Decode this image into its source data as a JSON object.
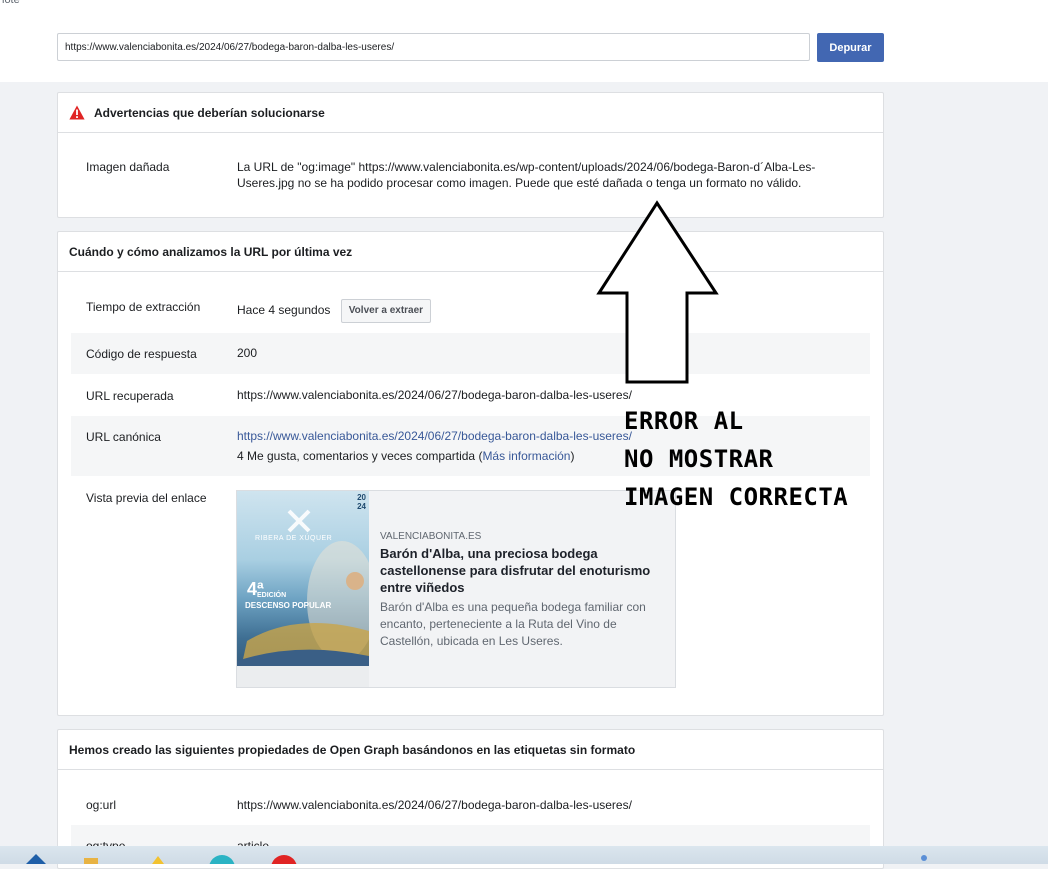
{
  "top": {
    "cut_text": "lote",
    "url_value": "https://www.valenciabonita.es/2024/06/27/bodega-baron-dalba-les-useres/",
    "debug_button": "Depurar"
  },
  "warnings": {
    "title": "Advertencias que deberían solucionarse",
    "label": "Imagen dañada",
    "message_line1": "La URL de \"og:image\" https://www.valenciabonita.es/wp-content/uploads/2024/06/bodega-Baron-d´Alba-Les-",
    "message_line2": "Useres.jpg no se ha podido procesar como imagen. Puede que esté dañada o tenga un formato no válido."
  },
  "scrape": {
    "title": "Cuándo y cómo analizamos la URL por última vez",
    "rows": [
      {
        "label": "Tiempo de extracción",
        "value": "Hace 4 segundos",
        "button": "Volver a extraer"
      },
      {
        "label": "Código de respuesta",
        "value": "200"
      },
      {
        "label": "URL recuperada",
        "value": "https://www.valenciabonita.es/2024/06/27/bodega-baron-dalba-les-useres/"
      },
      {
        "label": "URL canónica",
        "value": "https://www.valenciabonita.es/2024/06/27/bodega-baron-dalba-les-useres/",
        "extra_prefix": "4 Me gusta, comentarios y veces compartida (",
        "extra_link": "Más información",
        "extra_suffix": ")"
      },
      {
        "label": "Vista previa del enlace"
      }
    ],
    "preview": {
      "domain": "VALENCIABONITA.ES",
      "title": "Barón d'Alba, una preciosa bodega castellonense para disfrutar del enoturismo entre viñedos",
      "description": "Barón d'Alba es una pequeña bodega familiar con encanto, perteneciente a la Ruta del Vino de Castellón, ubicada en Les Useres.",
      "image_text": {
        "year_top": "20",
        "year_bottom": "24",
        "brand": "RIBERA DE XÚQUER",
        "edition_num": "4ª",
        "edition": "EDICIÓN",
        "event": "DESCENSO POPULAR"
      }
    }
  },
  "og": {
    "title": "Hemos creado las siguientes propiedades de Open Graph basándonos en las etiquetas sin formato",
    "rows": [
      {
        "label": "og:url",
        "value": "https://www.valenciabonita.es/2024/06/27/bodega-baron-dalba-les-useres/"
      },
      {
        "label": "og:type",
        "value": "article"
      }
    ]
  },
  "annotation": {
    "line1": "ERROR AL",
    "line2": "NO MOSTRAR",
    "line3": "IMAGEN CORRECTA"
  },
  "colors": {
    "accent": "#4267b2",
    "link": "#385898",
    "warning": "#e02424"
  }
}
